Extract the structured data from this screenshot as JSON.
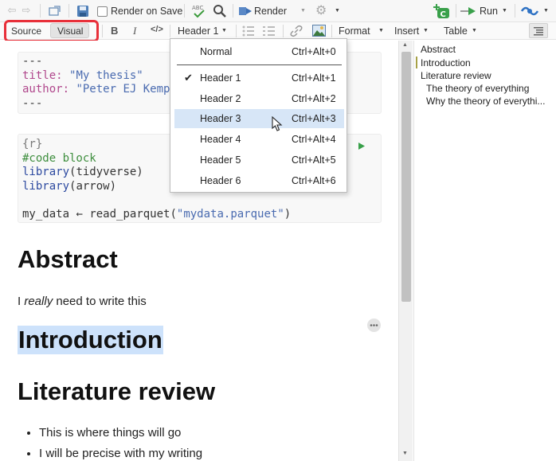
{
  "toolbar": {
    "render_on_save_label": "Render on Save",
    "render_label": "Render",
    "run_label": "Run"
  },
  "format_bar": {
    "source_label": "Source",
    "visual_label": "Visual",
    "bold_label": "B",
    "italic_label": "I",
    "code_label": "</>",
    "heading_select_value": "Header 1",
    "format_menu": "Format",
    "insert_menu": "Insert",
    "table_menu": "Table",
    "highlight_color": "#e8303a"
  },
  "heading_menu": {
    "items": [
      {
        "label": "Normal",
        "shortcut": "Ctrl+Alt+0"
      },
      {
        "label": "Header 1",
        "shortcut": "Ctrl+Alt+1"
      },
      {
        "label": "Header 2",
        "shortcut": "Ctrl+Alt+2"
      },
      {
        "label": "Header 3",
        "shortcut": "Ctrl+Alt+3"
      },
      {
        "label": "Header 4",
        "shortcut": "Ctrl+Alt+4"
      },
      {
        "label": "Header 5",
        "shortcut": "Ctrl+Alt+5"
      },
      {
        "label": "Header 6",
        "shortcut": "Ctrl+Alt+6"
      }
    ],
    "checked_item": "Header 1",
    "hovered_item": "Header 3",
    "check_glyph": "✔"
  },
  "yaml": {
    "dashes": "---",
    "title_key": "title:",
    "title_val": "\"My thesis\"",
    "author_key": "author:",
    "author_val": "\"Peter EJ Kemp",
    "end_dashes": "---"
  },
  "code_chunk": {
    "header": "{r}",
    "comment": "#code block",
    "lib1_fn": "library",
    "lib1_arg": "(tidyverse)",
    "lib2_fn": "library",
    "lib2_arg": "(arrow)",
    "assign_lhs": "my_data",
    "assign_op": " ← ",
    "assign_fn": "read_parquet(",
    "assign_str": "\"mydata.parquet\"",
    "assign_close": ")"
  },
  "document": {
    "h_abstract": "Abstract",
    "para_prefix": "I ",
    "para_em": "really",
    "para_suffix": " need to write this",
    "h_introduction": "Introduction",
    "h_literature": "Literature review",
    "bullets": [
      "This is where things will go",
      "I will be precise with my writing"
    ],
    "selection_color": "#cde2fb"
  },
  "outline": {
    "items": [
      {
        "label": "Abstract"
      },
      {
        "label": "Introduction"
      },
      {
        "label": "Literature review"
      },
      {
        "label": "The theory of everything"
      },
      {
        "label": "Why the theory of everythi..."
      }
    ],
    "active_marker_color": "#a7a146"
  }
}
